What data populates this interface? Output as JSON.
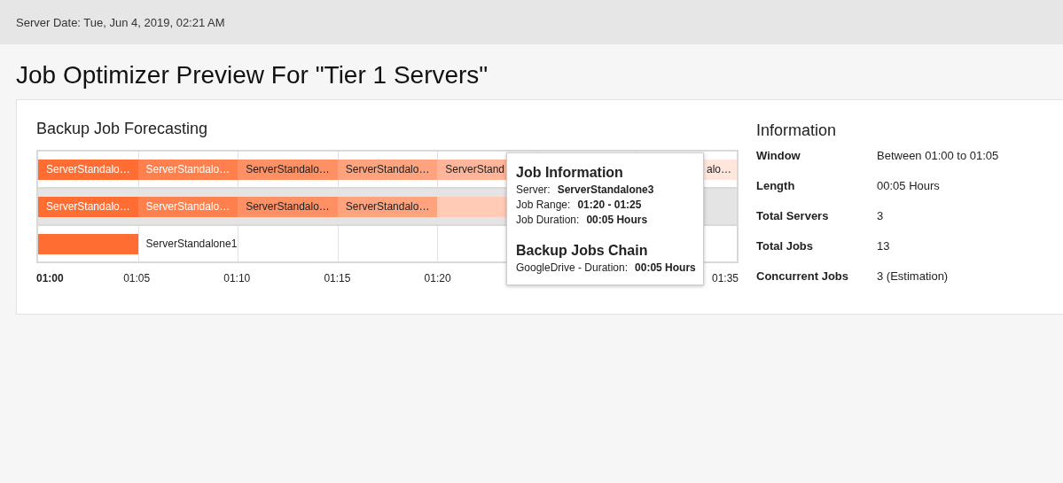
{
  "server_date": "Server Date: Tue, Jun 4, 2019, 02:21 AM",
  "title": "Job Optimizer Preview For \"Tier 1 Servers\"",
  "forecast": {
    "title": "Backup Job Forecasting",
    "ticks": [
      {
        "label": "01:00",
        "bold": true
      },
      {
        "label": "01:05",
        "bold": false
      },
      {
        "label": "01:10",
        "bold": false
      },
      {
        "label": "01:15",
        "bold": false
      },
      {
        "label": "01:20",
        "bold": false
      },
      {
        "label": "01:35",
        "bold": false
      }
    ],
    "rows": [
      {
        "shaded": false,
        "slots": [
          {
            "kind": "bar",
            "color": "#ff6d33",
            "label": "ServerStandalo…"
          },
          {
            "kind": "bar",
            "color": "#ff7f4d",
            "label": "ServerStandalo…"
          },
          {
            "kind": "bar",
            "color": "#ff9064",
            "label": "ServerStandalo…"
          },
          {
            "kind": "bar",
            "color": "#ffa27e",
            "label": "ServerStandalo…"
          },
          {
            "kind": "bar",
            "color": "#ffb599",
            "label": "ServerStand"
          },
          {
            "kind": "covered"
          },
          {
            "kind": "bar",
            "color": "#ffe6dc",
            "label": "alo…"
          }
        ]
      },
      {
        "shaded": true,
        "slots": [
          {
            "kind": "bar",
            "color": "#ff6d33",
            "label": "ServerStandalo…"
          },
          {
            "kind": "bar",
            "color": "#ff7f4d",
            "label": "ServerStandalo…"
          },
          {
            "kind": "bar",
            "color": "#ff9064",
            "label": "ServerStandalo…"
          },
          {
            "kind": "bar",
            "color": "#ffa27e",
            "label": "ServerStandalo…"
          },
          {
            "kind": "bar",
            "color": "#ffcbb6"
          }
        ]
      },
      {
        "shaded": false,
        "slots": [
          {
            "kind": "bar",
            "color": "#ff6d33"
          },
          {
            "kind": "caption",
            "label": "ServerStandalone1"
          }
        ]
      }
    ],
    "tooltip": {
      "title": "Job Information",
      "lines": [
        {
          "label": "Server:",
          "value": "ServerStandalone3"
        },
        {
          "label": "Job Range:",
          "value": "01:20 - 01:25"
        },
        {
          "label": "Job Duration:",
          "value": "00:05 Hours"
        }
      ],
      "chain_title": "Backup Jobs Chain",
      "chain": [
        {
          "label": "GoogleDrive - Duration:",
          "value": "00:05 Hours"
        }
      ]
    }
  },
  "information": {
    "title": "Information",
    "rows": [
      {
        "label": "Window",
        "value": "Between 01:00 to 01:05"
      },
      {
        "label": "Length",
        "value": "00:05 Hours"
      },
      {
        "label": "Total Servers",
        "value": "3"
      },
      {
        "label": "Total Jobs",
        "value": "13"
      },
      {
        "label": "Concurrent Jobs",
        "value": "3 (Estimation)"
      }
    ]
  }
}
